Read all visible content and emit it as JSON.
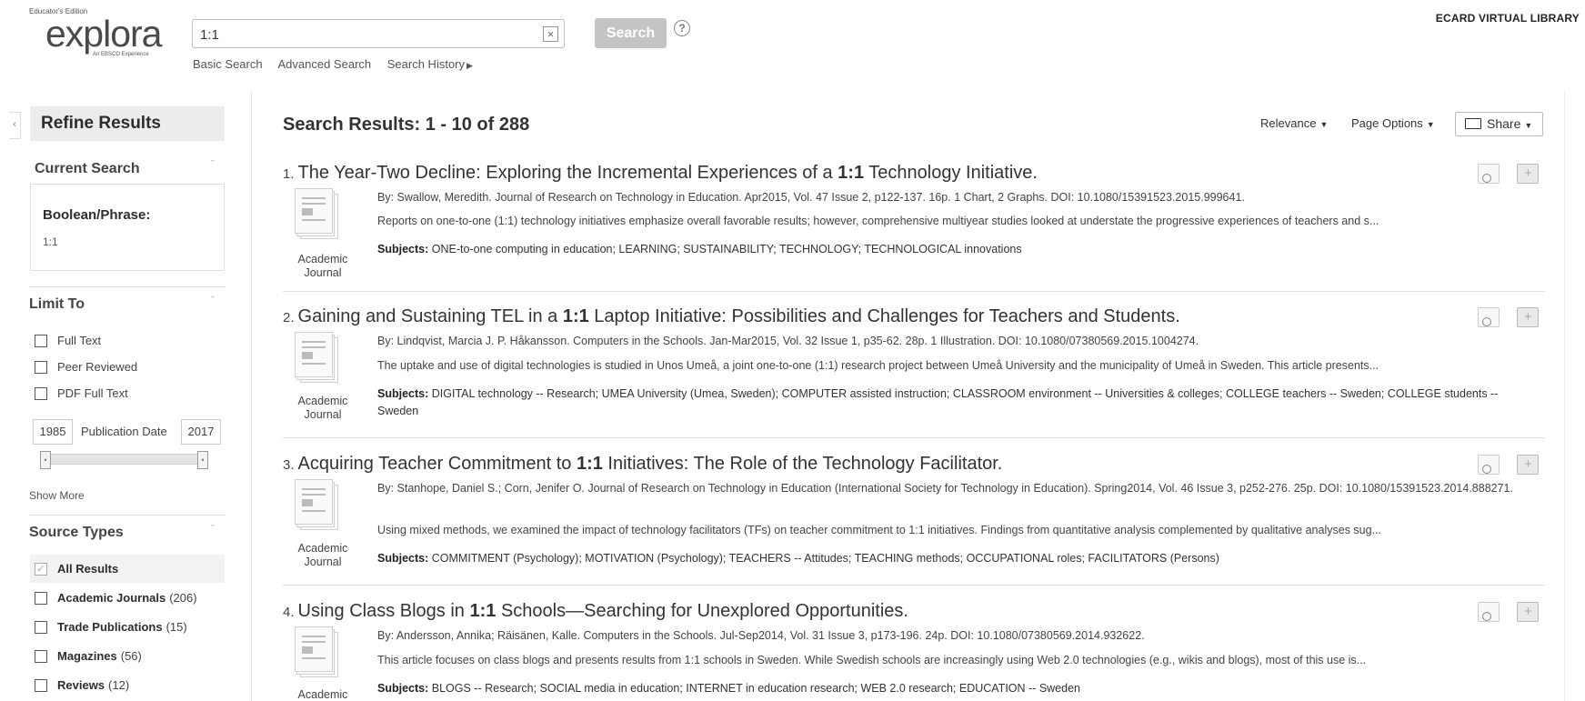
{
  "header": {
    "logo_edition": "Educator's Edition",
    "logo_wordmark": "explora",
    "logo_sub": "An EBSCO Experience",
    "search_value": "1:1",
    "search_button": "Search",
    "help": "?",
    "links": [
      "Basic Search",
      "Advanced Search",
      "Search History"
    ],
    "library": "ECARD VIRTUAL LIBRARY"
  },
  "sidebar": {
    "refine_title": "Refine Results",
    "current_search_title": "Current Search",
    "boolean_label": "Boolean/Phrase:",
    "boolean_value": "1:1",
    "limit_title": "Limit To",
    "limits": [
      "Full Text",
      "Peer Reviewed",
      "PDF Full Text"
    ],
    "date_from": "1985",
    "date_label": "Publication Date",
    "date_to": "2017",
    "show_more": "Show More",
    "source_title": "Source Types",
    "sources": [
      {
        "label": "All Results",
        "count": ""
      },
      {
        "label": "Academic Journals",
        "count": "(206)"
      },
      {
        "label": "Trade Publications",
        "count": "(15)"
      },
      {
        "label": "Magazines",
        "count": "(56)"
      },
      {
        "label": "Reviews",
        "count": "(12)"
      }
    ]
  },
  "results": {
    "title": "Search Results: 1 - 10 of 288",
    "sort_relevance": "Relevance",
    "page_options": "Page Options",
    "share": "Share",
    "items": [
      {
        "num": "1.",
        "title_pre": "The Year-Two Decline: Exploring the Incremental Experiences of a ",
        "title_hl": "1:1",
        "title_post": " Technology Initiative.",
        "meta": "By: Swallow, Meredith. Journal of Research on Technology in Education. Apr2015, Vol. 47 Issue 2, p122-137. 16p. 1 Chart, 2 Graphs. DOI: 10.1080/15391523.2015.999641.",
        "abstract": "Reports on one-to-one (1:1) technology initiatives emphasize overall favorable results; however, comprehensive multiyear studies looked at understate the progressive experiences of teachers and s...",
        "subjects_label": "Subjects:",
        "subjects": "ONE-to-one computing in education; LEARNING; SUSTAINABILITY; TECHNOLOGY; TECHNOLOGICAL innovations",
        "pub_type": "Academic Journal"
      },
      {
        "num": "2.",
        "title_pre": "Gaining and Sustaining TEL in a ",
        "title_hl": "1:1",
        "title_post": " Laptop Initiative: Possibilities and Challenges for Teachers and Students.",
        "meta": "By: Lindqvist, Marcia J. P. Håkansson. Computers in the Schools. Jan-Mar2015, Vol. 32 Issue 1, p35-62. 28p. 1 Illustration. DOI: 10.1080/07380569.2015.1004274.",
        "abstract": "The uptake and use of digital technologies is studied in Unos Umeå, a joint one-to-one (1:1) research project between Umeå University and the municipality of Umeå in Sweden. This article presents...",
        "subjects_label": "Subjects:",
        "subjects": "DIGITAL technology -- Research; UMEA University (Umea, Sweden); COMPUTER assisted instruction; CLASSROOM environment -- Universities & colleges; COLLEGE teachers -- Sweden; COLLEGE students -- Sweden",
        "pub_type": "Academic Journal"
      },
      {
        "num": "3.",
        "title_pre": "Acquiring Teacher Commitment to ",
        "title_hl": "1:1",
        "title_post": " Initiatives: The Role of the Technology Facilitator.",
        "meta": "By: Stanhope, Daniel S.; Corn, Jenifer O. Journal of Research on Technology in Education (International Society for Technology in Education). Spring2014, Vol. 46 Issue 3, p252-276. 25p. DOI: 10.1080/15391523.2014.888271.",
        "abstract": "Using mixed methods, we examined the impact of technology facilitators (TFs) on teacher commitment to 1:1 initiatives. Findings from quantitative analysis complemented by qualitative analyses sug...",
        "subjects_label": "Subjects:",
        "subjects": "COMMITMENT (Psychology); MOTIVATION (Psychology); TEACHERS -- Attitudes; TEACHING methods; OCCUPATIONAL roles; FACILITATORS (Persons)",
        "pub_type": "Academic Journal"
      },
      {
        "num": "4.",
        "title_pre": "Using Class Blogs in ",
        "title_hl": "1:1",
        "title_post": " Schools—Searching for Unexplored Opportunities.",
        "meta": "By: Andersson, Annika; Räisänen, Kalle. Computers in the Schools. Jul-Sep2014, Vol. 31 Issue 3, p173-196. 24p. DOI: 10.1080/07380569.2014.932622.",
        "abstract": "This article focuses on class blogs and presents results from 1:1 schools in Sweden. While Swedish schools are increasingly using Web 2.0 technologies (e.g., wikis and blogs), most of this use is...",
        "subjects_label": "Subjects:",
        "subjects": "BLOGS -- Research; SOCIAL media in education; INTERNET in education research; WEB 2.0 research; EDUCATION -- Sweden",
        "pub_type": "Academic"
      }
    ]
  }
}
